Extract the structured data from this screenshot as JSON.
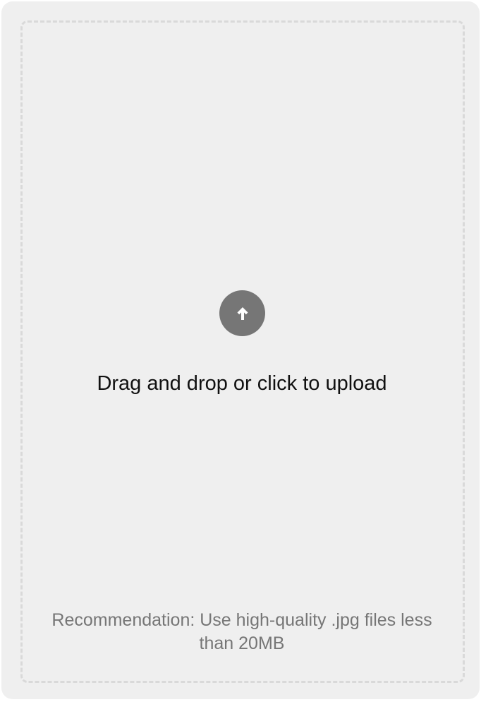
{
  "uploader": {
    "icon": "arrow-up-circle-icon",
    "title": "Drag and drop or click to upload",
    "recommendation": "Recommendation: Use high-quality .jpg files less than 20MB"
  },
  "colors": {
    "card_background": "#efefef",
    "dashed_border": "#d9d9d9",
    "icon_background": "#767676",
    "title_text": "#111111",
    "hint_text": "#767676"
  }
}
